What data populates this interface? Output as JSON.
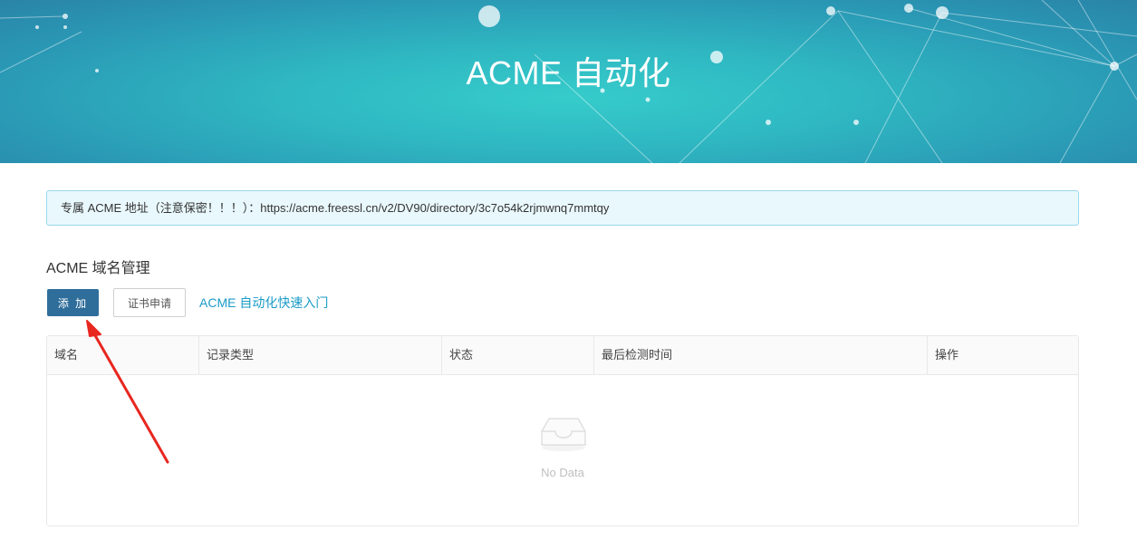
{
  "hero": {
    "title": "ACME 自动化"
  },
  "alert": {
    "text": "专属 ACME 地址（注意保密！！！）：https://acme.freessl.cn/v2/DV90/directory/3c7o54k2rjmwnq7mmtqy"
  },
  "section": {
    "title": "ACME 域名管理"
  },
  "toolbar": {
    "add_label": "添 加",
    "cert_label": "证书申请",
    "guide_link": "ACME 自动化快速入门"
  },
  "table": {
    "columns": [
      "域名",
      "记录类型",
      "状态",
      "最后检测时间",
      "操作"
    ],
    "empty_text": "No Data"
  },
  "colors": {
    "primary_button": "#2f6e9b",
    "link": "#1a9bc7",
    "alert_bg": "#e9f8fd",
    "annotation_arrow": "#e8271f"
  },
  "icons": {
    "empty": "empty-inbox-icon",
    "annotation": "red-arrow-annotation"
  }
}
